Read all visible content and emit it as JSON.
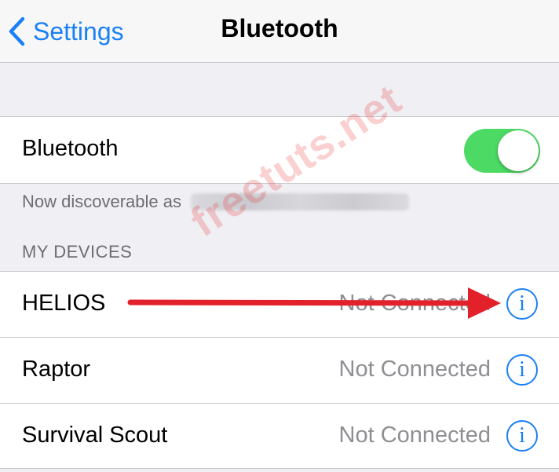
{
  "navbar": {
    "back_label": "Settings",
    "title": "Bluetooth"
  },
  "bluetooth": {
    "label": "Bluetooth",
    "enabled": true,
    "discoverable_text": "Now discoverable as"
  },
  "my_devices": {
    "header": "MY DEVICES",
    "devices": [
      {
        "name": "HELIOS",
        "status": "Not Connected"
      },
      {
        "name": "Raptor",
        "status": "Not Connected"
      },
      {
        "name": "Survival Scout",
        "status": "Not Connected"
      }
    ]
  },
  "watermark": "freetuts.net",
  "colors": {
    "accent": "#1a80f5",
    "toggle_on": "#4cd964",
    "annotation_arrow": "#e3212b",
    "secondary_text": "#8e8e93"
  }
}
